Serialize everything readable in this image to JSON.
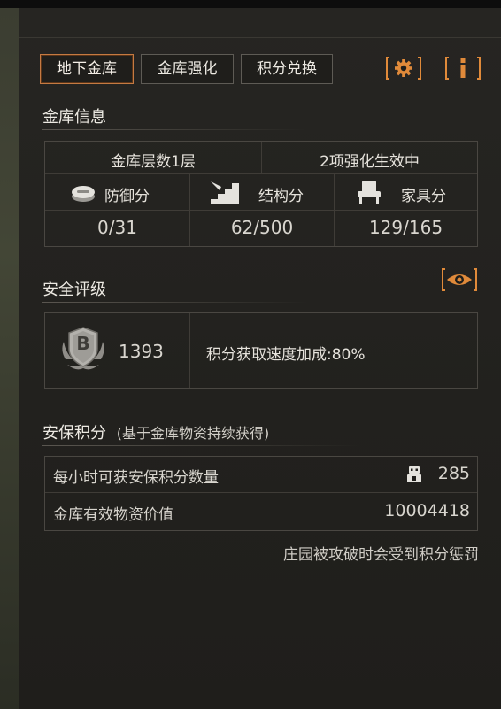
{
  "tabs": [
    {
      "label": "地下金库",
      "active": true
    },
    {
      "label": "金库强化",
      "active": false
    },
    {
      "label": "积分兑换",
      "active": false
    }
  ],
  "toolbar_icons": [
    "gear-icon",
    "info-icon"
  ],
  "vault_info": {
    "title": "金库信息",
    "level_text": "金库层数1层",
    "buffs_text": "2项强化生效中",
    "stats": [
      {
        "icon": "shield-disc-icon",
        "label": "防御分",
        "value": "0/31"
      },
      {
        "icon": "stairs-icon",
        "label": "结构分",
        "value": "62/500"
      },
      {
        "icon": "chair-icon",
        "label": "家具分",
        "value": "129/165"
      }
    ]
  },
  "security": {
    "title": "安全评级",
    "grade": "B",
    "score": "1393",
    "bonus_text": "积分获取速度加成:80%"
  },
  "points": {
    "title": "安保积分",
    "subtitle": "(基于金库物资持续获得)",
    "rows": [
      {
        "label": "每小时可获安保积分数量",
        "value": "285",
        "icon": "robot-icon"
      },
      {
        "label": "金库有效物资价值",
        "value": "10004418"
      }
    ],
    "penalty_note": "庄园被攻破时会受到积分惩罚"
  },
  "colors": {
    "accent": "#e08a3a",
    "background": "#1f1e1b",
    "border": "#4a4742",
    "text": "#e6e3dc"
  }
}
